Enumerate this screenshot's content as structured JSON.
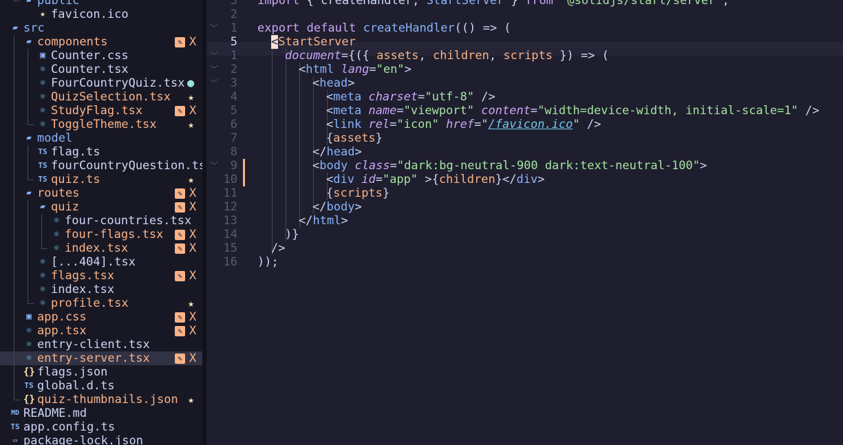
{
  "colors": {
    "background": "#1e1e2e",
    "sidebar": "#181825",
    "modified": "#fab387",
    "folder": "#89b4fa",
    "string": "#a6e3a1",
    "keyword": "#cba6f7"
  },
  "file_tree": [
    {
      "name": "public",
      "icon": "folder-open-icon",
      "type": "dir",
      "status": ""
    },
    {
      "name": "favicon.ico",
      "icon": "favicon-star-icon",
      "type": "file",
      "status": ""
    },
    {
      "name": "src",
      "icon": "folder-open-icon",
      "type": "dir",
      "status": ""
    },
    {
      "name": "components",
      "icon": "folder-open-icon",
      "type": "dir",
      "status": "modified"
    },
    {
      "name": "Counter.css",
      "icon": "css-icon",
      "type": "file",
      "status": ""
    },
    {
      "name": "Counter.tsx",
      "icon": "react-icon",
      "type": "file",
      "status": ""
    },
    {
      "name": "FourCountryQuiz.tsx",
      "icon": "react-icon",
      "type": "file",
      "status": "suggestion"
    },
    {
      "name": "QuizSelection.tsx",
      "icon": "react-icon",
      "type": "file",
      "status": "new"
    },
    {
      "name": "StudyFlag.tsx",
      "icon": "react-icon",
      "type": "file",
      "status": "modified"
    },
    {
      "name": "ToggleTheme.tsx",
      "icon": "react-icon",
      "type": "file",
      "status": "new"
    },
    {
      "name": "model",
      "icon": "folder-open-icon",
      "type": "dir",
      "status": ""
    },
    {
      "name": "flag.ts",
      "icon": "typescript-icon",
      "type": "file",
      "status": ""
    },
    {
      "name": "fourCountryQuestion.ts",
      "icon": "typescript-icon",
      "type": "file",
      "status": ""
    },
    {
      "name": "quiz.ts",
      "icon": "typescript-icon",
      "type": "file",
      "status": "new"
    },
    {
      "name": "routes",
      "icon": "folder-open-icon",
      "type": "dir",
      "status": "modified"
    },
    {
      "name": "quiz",
      "icon": "folder-open-icon",
      "type": "dir",
      "status": "modified"
    },
    {
      "name": "four-countries.tsx",
      "icon": "react-icon",
      "type": "file",
      "status": ""
    },
    {
      "name": "four-flags.tsx",
      "icon": "react-icon",
      "type": "file",
      "status": "modified"
    },
    {
      "name": "index.tsx",
      "icon": "react-icon",
      "type": "file",
      "status": "modified"
    },
    {
      "name": "[...404].tsx",
      "icon": "react-icon",
      "type": "file",
      "status": ""
    },
    {
      "name": "flags.tsx",
      "icon": "react-icon",
      "type": "file",
      "status": "modified"
    },
    {
      "name": "index.tsx",
      "icon": "react-icon",
      "type": "file",
      "status": ""
    },
    {
      "name": "profile.tsx",
      "icon": "react-icon",
      "type": "file",
      "status": "new"
    },
    {
      "name": "app.css",
      "icon": "css-icon",
      "type": "file",
      "status": "modified"
    },
    {
      "name": "app.tsx",
      "icon": "react-icon",
      "type": "file",
      "status": "modified"
    },
    {
      "name": "entry-client.tsx",
      "icon": "react-icon",
      "type": "file",
      "status": ""
    },
    {
      "name": "entry-server.tsx",
      "icon": "react-icon",
      "type": "file",
      "status": "modified",
      "selected": true
    },
    {
      "name": "flags.json",
      "icon": "json-icon",
      "type": "file",
      "status": ""
    },
    {
      "name": "global.d.ts",
      "icon": "typescript-icon",
      "type": "file",
      "status": ""
    },
    {
      "name": "quiz-thumbnails.json",
      "icon": "json-icon",
      "type": "file",
      "status": "new"
    },
    {
      "name": "README.md",
      "icon": "markdown-icon",
      "type": "file",
      "status": ""
    },
    {
      "name": "app.config.ts",
      "icon": "typescript-icon",
      "type": "file",
      "status": ""
    },
    {
      "name": "package-lock.json",
      "icon": "package-icon",
      "type": "file",
      "status": ""
    }
  ],
  "status_marks": {
    "edit": "✎",
    "x": "X",
    "star": "★",
    "bulb": "💡"
  },
  "editor": {
    "line_numbers": [
      "3",
      "2",
      "1",
      "5",
      "1",
      "2",
      "3",
      "4",
      "5",
      "6",
      "7",
      "8",
      "9",
      "10",
      "11",
      "12",
      "13",
      "14",
      "15",
      "16"
    ],
    "current_line": 5,
    "lines": [
      [
        [
          "k",
          "import"
        ],
        [
          "p",
          " { createHandler, "
        ],
        [
          "f",
          "StartServer"
        ],
        [
          "p",
          " } "
        ],
        [
          "k",
          "from"
        ],
        [
          "p",
          " "
        ],
        [
          "s",
          "\"@solidjs/start/server\""
        ],
        [
          "p",
          ";"
        ]
      ],
      [],
      [
        [
          "k",
          "export"
        ],
        [
          "p",
          " "
        ],
        [
          "k",
          "default"
        ],
        [
          "p",
          " "
        ],
        [
          "f",
          "createHandler"
        ],
        [
          "p",
          "(() => ("
        ]
      ],
      [
        [
          "blk",
          "<"
        ],
        [
          "c",
          "StartServer"
        ]
      ],
      [
        [
          "a",
          "document"
        ],
        [
          "p",
          "={({ "
        ],
        [
          "v",
          "assets"
        ],
        [
          "p",
          ", "
        ],
        [
          "v",
          "children"
        ],
        [
          "p",
          ", "
        ],
        [
          "v",
          "scripts"
        ],
        [
          "p",
          " }) => ("
        ]
      ],
      [
        [
          "p",
          "<"
        ],
        [
          "t",
          "html"
        ],
        [
          "p",
          " "
        ],
        [
          "a",
          "lang"
        ],
        [
          "p",
          "="
        ],
        [
          "s",
          "\"en\""
        ],
        [
          "p",
          ">"
        ]
      ],
      [
        [
          "p",
          "<"
        ],
        [
          "t",
          "head"
        ],
        [
          "p",
          ">"
        ]
      ],
      [
        [
          "p",
          "<"
        ],
        [
          "t",
          "meta"
        ],
        [
          "p",
          " "
        ],
        [
          "a",
          "charset"
        ],
        [
          "p",
          "="
        ],
        [
          "s",
          "\"utf-8\""
        ],
        [
          "p",
          " />"
        ]
      ],
      [
        [
          "p",
          "<"
        ],
        [
          "t",
          "meta"
        ],
        [
          "p",
          " "
        ],
        [
          "a",
          "name"
        ],
        [
          "p",
          "="
        ],
        [
          "s",
          "\"viewport\""
        ],
        [
          "p",
          " "
        ],
        [
          "a",
          "content"
        ],
        [
          "p",
          "="
        ],
        [
          "s",
          "\"width=device-width, initial-scale=1\""
        ],
        [
          "p",
          " />"
        ]
      ],
      [
        [
          "p",
          "<"
        ],
        [
          "t",
          "link"
        ],
        [
          "p",
          " "
        ],
        [
          "a",
          "rel"
        ],
        [
          "p",
          "="
        ],
        [
          "s",
          "\"icon\""
        ],
        [
          "p",
          " "
        ],
        [
          "a",
          "href"
        ],
        [
          "p",
          "="
        ],
        [
          "s",
          "\""
        ],
        [
          "u",
          "/favicon.ico"
        ],
        [
          "s",
          "\""
        ],
        [
          "p",
          " />"
        ]
      ],
      [
        [
          "p",
          "{"
        ],
        [
          "v",
          "assets"
        ],
        [
          "p",
          "}"
        ]
      ],
      [
        [
          "p",
          "</"
        ],
        [
          "t",
          "head"
        ],
        [
          "p",
          ">"
        ]
      ],
      [
        [
          "p",
          "<"
        ],
        [
          "t",
          "body"
        ],
        [
          "p",
          " "
        ],
        [
          "a",
          "class"
        ],
        [
          "p",
          "="
        ],
        [
          "s",
          "\"dark:bg-neutral-900 dark:text-neutral-100\""
        ],
        [
          "p",
          ">"
        ]
      ],
      [
        [
          "p",
          "<"
        ],
        [
          "t",
          "div"
        ],
        [
          "p",
          " "
        ],
        [
          "a",
          "id"
        ],
        [
          "p",
          "="
        ],
        [
          "s",
          "\"app\""
        ],
        [
          "p",
          " >{"
        ],
        [
          "v",
          "children"
        ],
        [
          "p",
          "}</"
        ],
        [
          "t",
          "div"
        ],
        [
          "p",
          ">"
        ]
      ],
      [
        [
          "p",
          "{"
        ],
        [
          "v",
          "scripts"
        ],
        [
          "p",
          "}"
        ]
      ],
      [
        [
          "p",
          "</"
        ],
        [
          "t",
          "body"
        ],
        [
          "p",
          ">"
        ]
      ],
      [
        [
          "p",
          "</"
        ],
        [
          "t",
          "html"
        ],
        [
          "p",
          ">"
        ]
      ],
      [
        [
          "p",
          ")}"
        ]
      ],
      [
        [
          "p",
          "/>"
        ]
      ],
      [
        [
          "p",
          "));"
        ]
      ]
    ]
  }
}
